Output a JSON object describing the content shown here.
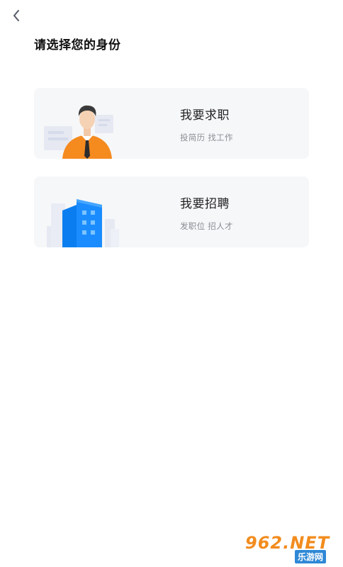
{
  "header": {
    "back_icon": "chevron-left-icon",
    "title": "请选择您的身份"
  },
  "options": [
    {
      "id": "job-seeker",
      "title": "我要求职",
      "subtitle": "投简历 找工作",
      "illustration": "job-seeker-illustration",
      "accent_color": "#f58a1f"
    },
    {
      "id": "recruiter",
      "title": "我要招聘",
      "subtitle": "发职位 招人才",
      "illustration": "office-building-illustration",
      "accent_color": "#1a8cff"
    }
  ],
  "watermark": {
    "main": "962.NET",
    "sub": "乐游网"
  },
  "colors": {
    "card_background": "#f6f7f9",
    "title_text": "#111111",
    "subtitle_text": "#8a8d93"
  }
}
